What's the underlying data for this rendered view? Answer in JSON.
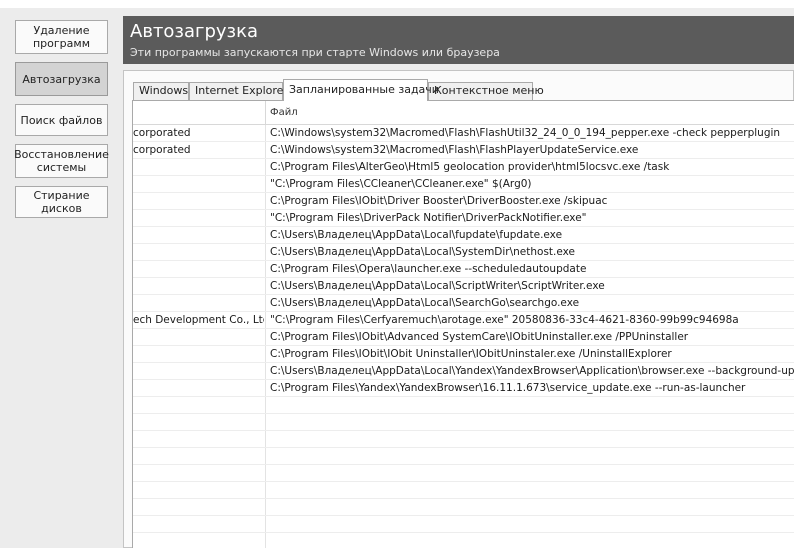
{
  "sidebar": {
    "items": [
      {
        "label": "Удаление\nпрограмм",
        "active": false
      },
      {
        "label": "Автозагрузка",
        "active": true
      },
      {
        "label": "Поиск файлов",
        "active": false
      },
      {
        "label": "Восстановление\nсистемы",
        "active": false
      },
      {
        "label": "Стирание дисков",
        "active": false
      }
    ]
  },
  "header": {
    "title": "Автозагрузка",
    "subtitle": "Эти программы запускаются при старте Windows или браузера"
  },
  "tabs": [
    {
      "label": "Windows",
      "active": false
    },
    {
      "label": "Internet Explorer",
      "active": false
    },
    {
      "label": "Запланированные задачи",
      "active": true
    },
    {
      "label": "Контекстное меню",
      "active": false
    }
  ],
  "table": {
    "columns": [
      "",
      "Файл"
    ],
    "rows": [
      {
        "publisher": "corporated",
        "file": "C:\\Windows\\system32\\Macromed\\Flash\\FlashUtil32_24_0_0_194_pepper.exe -check pepperplugin"
      },
      {
        "publisher": "corporated",
        "file": "C:\\Windows\\system32\\Macromed\\Flash\\FlashPlayerUpdateService.exe"
      },
      {
        "publisher": "",
        "file": "C:\\Program Files\\AlterGeo\\Html5 geolocation provider\\html5locsvc.exe /task"
      },
      {
        "publisher": "",
        "file": "\"C:\\Program Files\\CCleaner\\CCleaner.exe\" $(Arg0)"
      },
      {
        "publisher": "",
        "file": "C:\\Program Files\\IObit\\Driver Booster\\DriverBooster.exe /skipuac"
      },
      {
        "publisher": "",
        "file": "\"C:\\Program Files\\DriverPack Notifier\\DriverPackNotifier.exe\""
      },
      {
        "publisher": "",
        "file": "C:\\Users\\Владелец\\AppData\\Local\\fupdate\\fupdate.exe"
      },
      {
        "publisher": "",
        "file": "C:\\Users\\Владелец\\AppData\\Local\\SystemDir\\nethost.exe"
      },
      {
        "publisher": "",
        "file": "C:\\Program Files\\Opera\\launcher.exe --scheduledautoupdate"
      },
      {
        "publisher": "",
        "file": "C:\\Users\\Владелец\\AppData\\Local\\ScriptWriter\\ScriptWriter.exe"
      },
      {
        "publisher": "",
        "file": "C:\\Users\\Владелец\\AppData\\Local\\SearchGo\\searchgo.exe"
      },
      {
        "publisher": "ech Development Co., Ltd",
        "file": "\"C:\\Program Files\\Cerfyaremuch\\arotage.exe\" 20580836-33c4-4621-8360-99b99c94698a"
      },
      {
        "publisher": "",
        "file": "C:\\Program Files\\IObit\\Advanced SystemCare\\IObitUninstaller.exe /PPUninstaller"
      },
      {
        "publisher": "",
        "file": "C:\\Program Files\\IObit\\IObit Uninstaller\\IObitUninstaler.exe /UninstallExplorer"
      },
      {
        "publisher": "",
        "file": "C:\\Users\\Владелец\\AppData\\Local\\Yandex\\YandexBrowser\\Application\\browser.exe --background-update"
      },
      {
        "publisher": "",
        "file": "C:\\Program Files\\Yandex\\YandexBrowser\\16.11.1.673\\service_update.exe --run-as-launcher"
      }
    ]
  }
}
